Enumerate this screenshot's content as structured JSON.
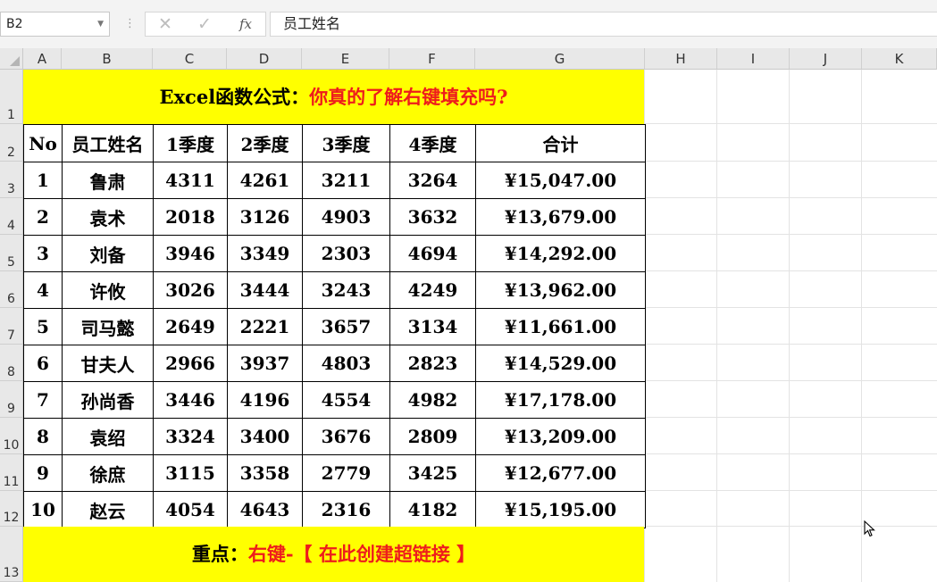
{
  "formula_bar": {
    "name_box": "B2",
    "cancel_icon": "✕",
    "enter_icon": "✓",
    "fx_label": "fx",
    "content": "员工姓名"
  },
  "columns": [
    "A",
    "B",
    "C",
    "D",
    "E",
    "F",
    "G",
    "H",
    "I",
    "J",
    "K"
  ],
  "rows": [
    "1",
    "2",
    "3",
    "4",
    "5",
    "6",
    "7",
    "8",
    "9",
    "10",
    "11",
    "12",
    "13"
  ],
  "title": {
    "prefix": "Excel函数公式：",
    "highlight": "你真的了解右键填充吗?"
  },
  "table": {
    "headers": [
      "No",
      "员工姓名",
      "1季度",
      "2季度",
      "3季度",
      "4季度",
      "合计"
    ],
    "rows": [
      [
        "1",
        "鲁肃",
        "4311",
        "4261",
        "3211",
        "3264",
        "¥15,047.00"
      ],
      [
        "2",
        "袁术",
        "2018",
        "3126",
        "4903",
        "3632",
        "¥13,679.00"
      ],
      [
        "3",
        "刘备",
        "3946",
        "3349",
        "2303",
        "4694",
        "¥14,292.00"
      ],
      [
        "4",
        "许攸",
        "3026",
        "3444",
        "3243",
        "4249",
        "¥13,962.00"
      ],
      [
        "5",
        "司马懿",
        "2649",
        "2221",
        "3657",
        "3134",
        "¥11,661.00"
      ],
      [
        "6",
        "甘夫人",
        "2966",
        "3937",
        "4803",
        "2823",
        "¥14,529.00"
      ],
      [
        "7",
        "孙尚香",
        "3446",
        "4196",
        "4554",
        "4982",
        "¥17,178.00"
      ],
      [
        "8",
        "袁绍",
        "3324",
        "3400",
        "3676",
        "2809",
        "¥13,209.00"
      ],
      [
        "9",
        "徐庶",
        "3115",
        "3358",
        "2779",
        "3425",
        "¥12,677.00"
      ],
      [
        "10",
        "赵云",
        "4054",
        "4643",
        "2316",
        "4182",
        "¥15,195.00"
      ]
    ]
  },
  "footer": {
    "prefix": "重点：",
    "highlight": "右键-【 在此创建超链接 】"
  },
  "colors": {
    "highlight_fill": "#ffff00",
    "accent_text": "#ee1c1c"
  }
}
